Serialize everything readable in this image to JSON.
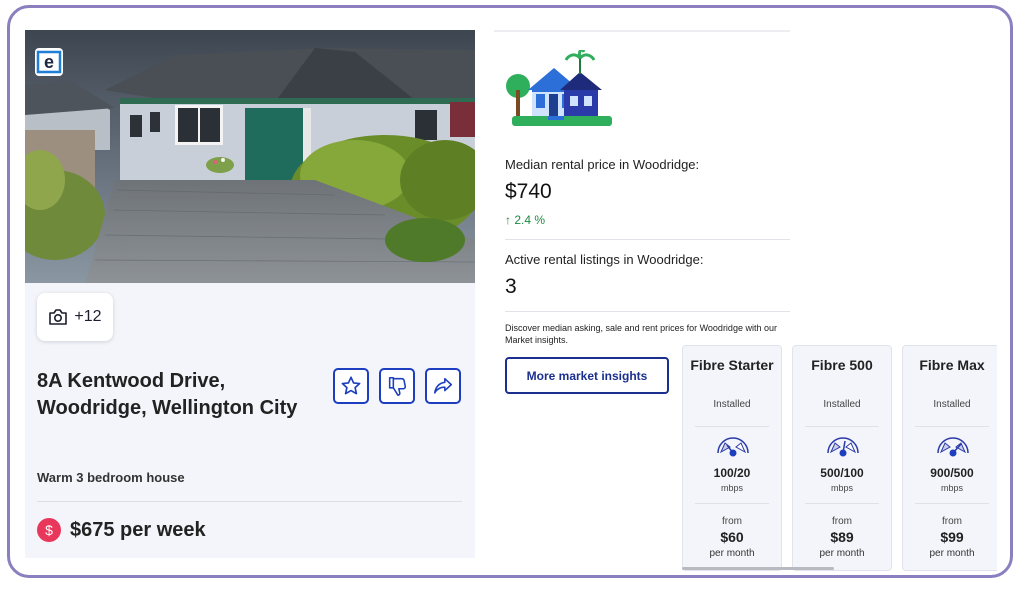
{
  "listing": {
    "photo_count": "+12",
    "address": "8A Kentwood Drive, Woodridge, Wellington City",
    "description": "Warm 3 bedroom house",
    "price": "$675 per week",
    "currency_symbol": "$"
  },
  "market": {
    "median_label": "Median rental price in Woodridge:",
    "median_value": "$740",
    "median_change": "↑ 2.4 %",
    "listings_label": "Active rental listings in Woodridge:",
    "listings_value": "3",
    "discover_text": "Discover median asking, sale and rent prices for Woodridge with our Market insights.",
    "button_label": "More market insights"
  },
  "plans": [
    {
      "name": "Fibre Starter",
      "status": "Installed",
      "speed": "100/20",
      "unit": "mbps",
      "from": "from",
      "price": "$60",
      "per": "per month"
    },
    {
      "name": "Fibre 500",
      "status": "Installed",
      "speed": "500/100",
      "unit": "mbps",
      "from": "from",
      "price": "$89",
      "per": "per month"
    },
    {
      "name": "Fibre Max",
      "status": "Installed",
      "speed": "900/500",
      "unit": "mbps",
      "from": "from",
      "price": "$99",
      "per": "per month"
    }
  ],
  "colors": {
    "accent_blue": "#1d3fbf",
    "price_badge": "#e8375a",
    "positive_change": "#1c8a42",
    "frame_border": "#8b7fc0"
  },
  "icons": [
    "camera-icon",
    "star-icon",
    "thumbs-down-icon",
    "share-icon",
    "dollar-icon",
    "speed-gauge-icon",
    "house-illustration"
  ]
}
